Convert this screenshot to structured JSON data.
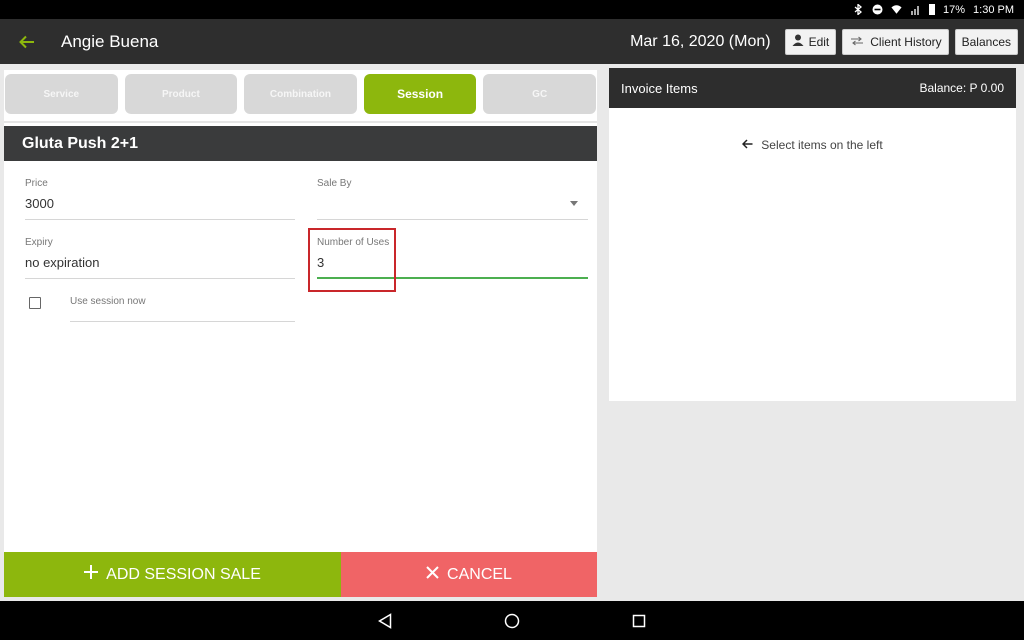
{
  "status_bar": {
    "battery": "17%",
    "time": "1:30 PM"
  },
  "header": {
    "client_name": "Angie Buena",
    "date": "Mar 16, 2020 (Mon)",
    "edit_label": "Edit",
    "history_label": "Client History",
    "balances_label": "Balances"
  },
  "tabs": [
    {
      "label": "Service"
    },
    {
      "label": "Product"
    },
    {
      "label": "Combination"
    },
    {
      "label": "Session"
    },
    {
      "label": "GC"
    }
  ],
  "active_tab": "Session",
  "item": {
    "title": "Gluta Push 2+1",
    "price_label": "Price",
    "price_value": "3000",
    "sale_by_label": "Sale By",
    "sale_by_value": "",
    "expiry_label": "Expiry",
    "expiry_value": "no expiration",
    "uses_label": "Number of Uses",
    "uses_value": "3",
    "use_now_label": "Use session now"
  },
  "actions": {
    "add_label": "ADD SESSION SALE",
    "cancel_label": "CANCEL"
  },
  "invoice": {
    "title": "Invoice Items",
    "balance": "Balance: P 0.00",
    "hint": "Select items on the left"
  },
  "colors": {
    "accent": "#8db70d",
    "cancel": "#f06466",
    "focus_line": "#4caf50",
    "highlight": "#c9262a"
  }
}
